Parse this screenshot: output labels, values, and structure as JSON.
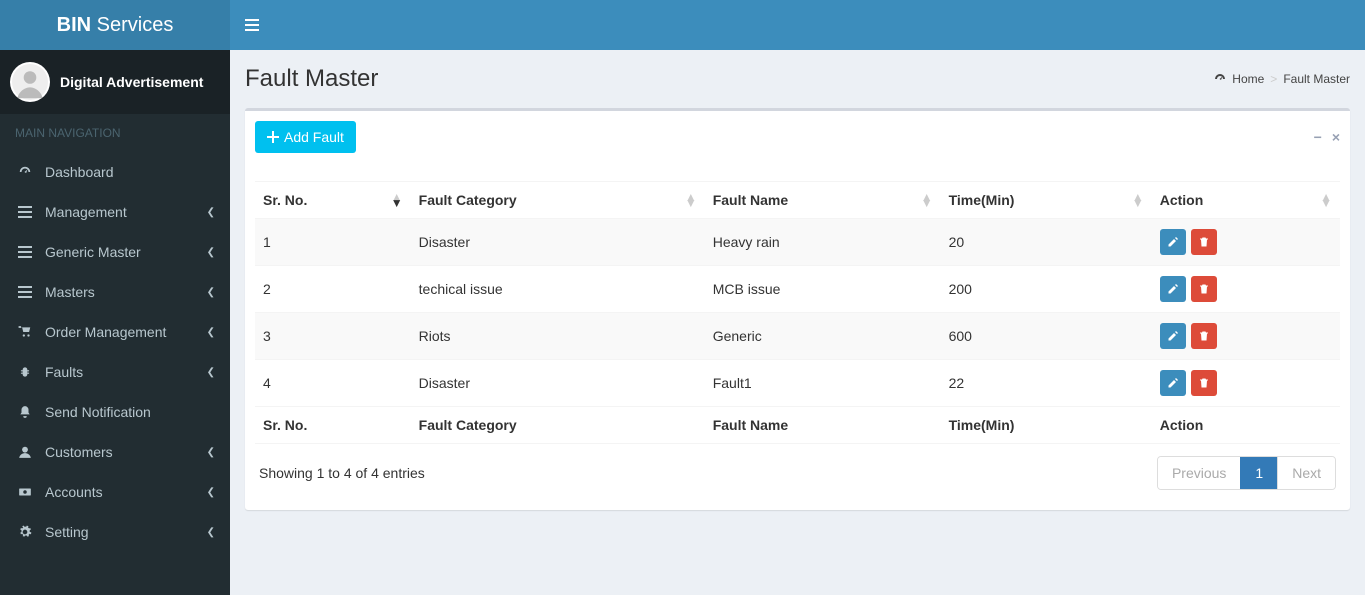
{
  "brand": {
    "bold": "BIN",
    "rest": " Services"
  },
  "user": {
    "name": "Digital Advertisement"
  },
  "sidebar_header": "MAIN NAVIGATION",
  "sidebar": {
    "items": [
      {
        "label": "Dashboard",
        "icon": "tachometer",
        "has_children": false
      },
      {
        "label": "Management",
        "icon": "bars",
        "has_children": true
      },
      {
        "label": "Generic Master",
        "icon": "bars",
        "has_children": true
      },
      {
        "label": "Masters",
        "icon": "bars",
        "has_children": true
      },
      {
        "label": "Order Management",
        "icon": "cart",
        "has_children": true
      },
      {
        "label": "Faults",
        "icon": "bug",
        "has_children": true
      },
      {
        "label": "Send Notification",
        "icon": "bell",
        "has_children": false
      },
      {
        "label": "Customers",
        "icon": "user",
        "has_children": true
      },
      {
        "label": "Accounts",
        "icon": "money",
        "has_children": true
      },
      {
        "label": "Setting",
        "icon": "gear",
        "has_children": true
      }
    ]
  },
  "page_title": "Fault Master",
  "breadcrumb": {
    "home": "Home",
    "current": "Fault Master"
  },
  "add_button": "Add Fault",
  "columns": {
    "sr": "Sr. No.",
    "cat": "Fault Category",
    "name": "Fault Name",
    "time": "Time(Min)",
    "action": "Action"
  },
  "rows": [
    {
      "sr": "1",
      "cat": "Disaster",
      "name": "Heavy rain",
      "time": "20"
    },
    {
      "sr": "2",
      "cat": "techical issue",
      "name": "MCB issue",
      "time": "200"
    },
    {
      "sr": "3",
      "cat": "Riots",
      "name": "Generic",
      "time": "600"
    },
    {
      "sr": "4",
      "cat": "Disaster",
      "name": "Fault1",
      "time": "22"
    }
  ],
  "info_text": "Showing 1 to 4 of 4 entries",
  "pagination": {
    "prev": "Previous",
    "page1": "1",
    "next": "Next"
  }
}
